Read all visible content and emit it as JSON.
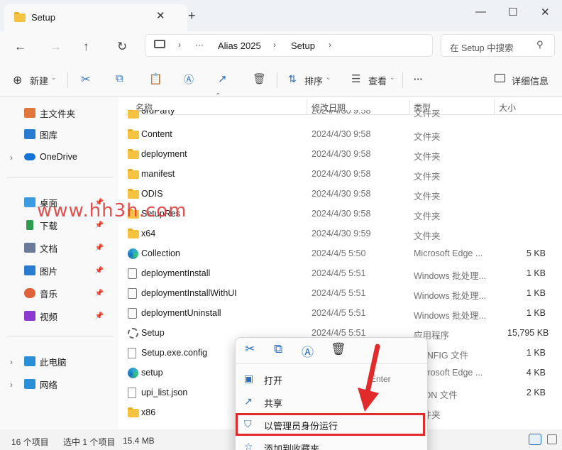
{
  "window": {
    "tab_title": "Setup",
    "tab_close": "✕",
    "new_tab": "+",
    "minimize": "—",
    "maximize": "☐",
    "close": "✕"
  },
  "address": {
    "back": "←",
    "forward": "→",
    "up": "↑",
    "refresh": "↻",
    "ellipsis": "···",
    "path": [
      "Alias 2025",
      "Setup"
    ],
    "search_placeholder": "在 Setup 中搜索"
  },
  "commands": {
    "new": "新建",
    "sort": "排序",
    "view": "查看",
    "more": "···",
    "details": "详细信息"
  },
  "sidebar": {
    "items": [
      {
        "label": "主文件夹",
        "icon": "home-icon",
        "color": "#e0763a"
      },
      {
        "label": "图库",
        "icon": "gallery-icon",
        "color": "#2a7cd0"
      },
      {
        "label": "OneDrive",
        "icon": "cloud-icon",
        "color": "#1473d6"
      },
      {
        "label": "桌面",
        "icon": "desktop-icon",
        "color": "#3a9be0"
      },
      {
        "label": "下载",
        "icon": "download-icon",
        "color": "#2e9b4e"
      },
      {
        "label": "文档",
        "icon": "document-icon",
        "color": "#6b7a99"
      },
      {
        "label": "图片",
        "icon": "picture-icon",
        "color": "#2a7cd0"
      },
      {
        "label": "音乐",
        "icon": "music-icon",
        "color": "#e0623a"
      },
      {
        "label": "视频",
        "icon": "video-icon",
        "color": "#8b3ad0"
      },
      {
        "label": "此电脑",
        "icon": "computer-icon",
        "color": "#2a8fd6"
      },
      {
        "label": "网络",
        "icon": "network-icon",
        "color": "#2a8fd6"
      }
    ]
  },
  "columns": {
    "name": "名称",
    "date": "修改日期",
    "type": "类型",
    "size": "大小"
  },
  "files": [
    {
      "name": "3rdParty",
      "date": "2024/4/30 9:58",
      "type": "文件夹",
      "size": "",
      "icon": "folder"
    },
    {
      "name": "Content",
      "date": "2024/4/30 9:58",
      "type": "文件夹",
      "size": "",
      "icon": "folder"
    },
    {
      "name": "deployment",
      "date": "2024/4/30 9:58",
      "type": "文件夹",
      "size": "",
      "icon": "folder"
    },
    {
      "name": "manifest",
      "date": "2024/4/30 9:58",
      "type": "文件夹",
      "size": "",
      "icon": "folder"
    },
    {
      "name": "ODIS",
      "date": "2024/4/30 9:58",
      "type": "文件夹",
      "size": "",
      "icon": "folder"
    },
    {
      "name": "SetupRes",
      "date": "2024/4/30 9:58",
      "type": "文件夹",
      "size": "",
      "icon": "folder"
    },
    {
      "name": "x64",
      "date": "2024/4/30 9:59",
      "type": "文件夹",
      "size": "",
      "icon": "folder"
    },
    {
      "name": "Collection",
      "date": "2024/4/5 5:50",
      "type": "Microsoft Edge ...",
      "size": "5 KB",
      "icon": "edge"
    },
    {
      "name": "deploymentInstall",
      "date": "2024/4/5 5:51",
      "type": "Windows 批处理...",
      "size": "1 KB",
      "icon": "bat"
    },
    {
      "name": "deploymentInstallWithUI",
      "date": "2024/4/5 5:51",
      "type": "Windows 批处理...",
      "size": "1 KB",
      "icon": "bat"
    },
    {
      "name": "deploymentUninstall",
      "date": "2024/4/5 5:51",
      "type": "Windows 批处理...",
      "size": "1 KB",
      "icon": "bat"
    },
    {
      "name": "Setup",
      "date": "2024/4/5 5:51",
      "type": "应用程序",
      "size": "15,795 KB",
      "icon": "gear"
    },
    {
      "name": "Setup.exe.config",
      "date": "",
      "type": "CONFIG 文件",
      "size": "1 KB",
      "icon": "doc"
    },
    {
      "name": "setup",
      "date": "",
      "type": "Microsoft Edge ...",
      "size": "4 KB",
      "icon": "edge"
    },
    {
      "name": "upi_list.json",
      "date": "",
      "type": "JSON 文件",
      "size": "2 KB",
      "icon": "doc"
    },
    {
      "name": "x86",
      "date": "",
      "type": "文件夹",
      "size": "",
      "icon": "folder"
    }
  ],
  "status": {
    "count": "16 个项目",
    "selected": "选中 1 个项目",
    "size": "15.4 MB"
  },
  "context_menu": {
    "quick_actions": [
      "cut-icon",
      "copy-icon",
      "rename-icon",
      "delete-icon"
    ],
    "items": [
      {
        "label": "打开",
        "shortcut": "Enter",
        "icon": "open-icon"
      },
      {
        "label": "共享",
        "icon": "share-icon"
      },
      {
        "label": "以管理员身份运行",
        "icon": "shield-icon"
      },
      {
        "label": "添加到收藏夹",
        "icon": "star-icon"
      }
    ]
  },
  "watermark": "www.hh3h.com",
  "colors": {
    "highlight": "#e12b2b",
    "folder": "#f5c242",
    "accent": "#1b6fc7"
  }
}
